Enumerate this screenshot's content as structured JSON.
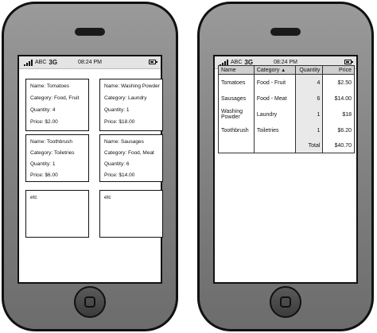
{
  "status": {
    "carrier": "ABC",
    "network": "3G",
    "time": "08:24 PM"
  },
  "cards": [
    {
      "name": "Name: Tomatoes",
      "category": "Category: Food, Fruit",
      "quantity": "Quantity: 4",
      "price": "Price: $2.00"
    },
    {
      "name": "Name: Washing Powder",
      "category": "Category: Laundry",
      "quantity": "Quantity: 1",
      "price": "Price: $18.00"
    },
    {
      "name": "Name: Toothbrush",
      "category": "Category: Toiletries",
      "quantity": "Quantity: 1",
      "price": "Price: $6.00"
    },
    {
      "name": "Name: Sausages",
      "category": "Category: Food, Meat",
      "quantity": "Quantity: 6",
      "price": "Price: $14.00"
    },
    {
      "text": "etc"
    },
    {
      "text": "etc"
    }
  ],
  "table": {
    "headers": [
      "Name",
      "Category",
      "Quantity",
      "Price"
    ],
    "sort_indicator": "▲",
    "rows": [
      [
        "Tomatoes",
        "Food - Fruit",
        "4",
        "$2.50"
      ],
      [
        "Sausages",
        "Food - Meat",
        "6",
        "$14.00"
      ],
      [
        "Washing Powder",
        "Laundry",
        "1",
        "$18"
      ],
      [
        "Toothbrush",
        "Toiletries",
        "1",
        "$6.20"
      ]
    ],
    "total_label": "Total",
    "total_value": "$40.70"
  }
}
